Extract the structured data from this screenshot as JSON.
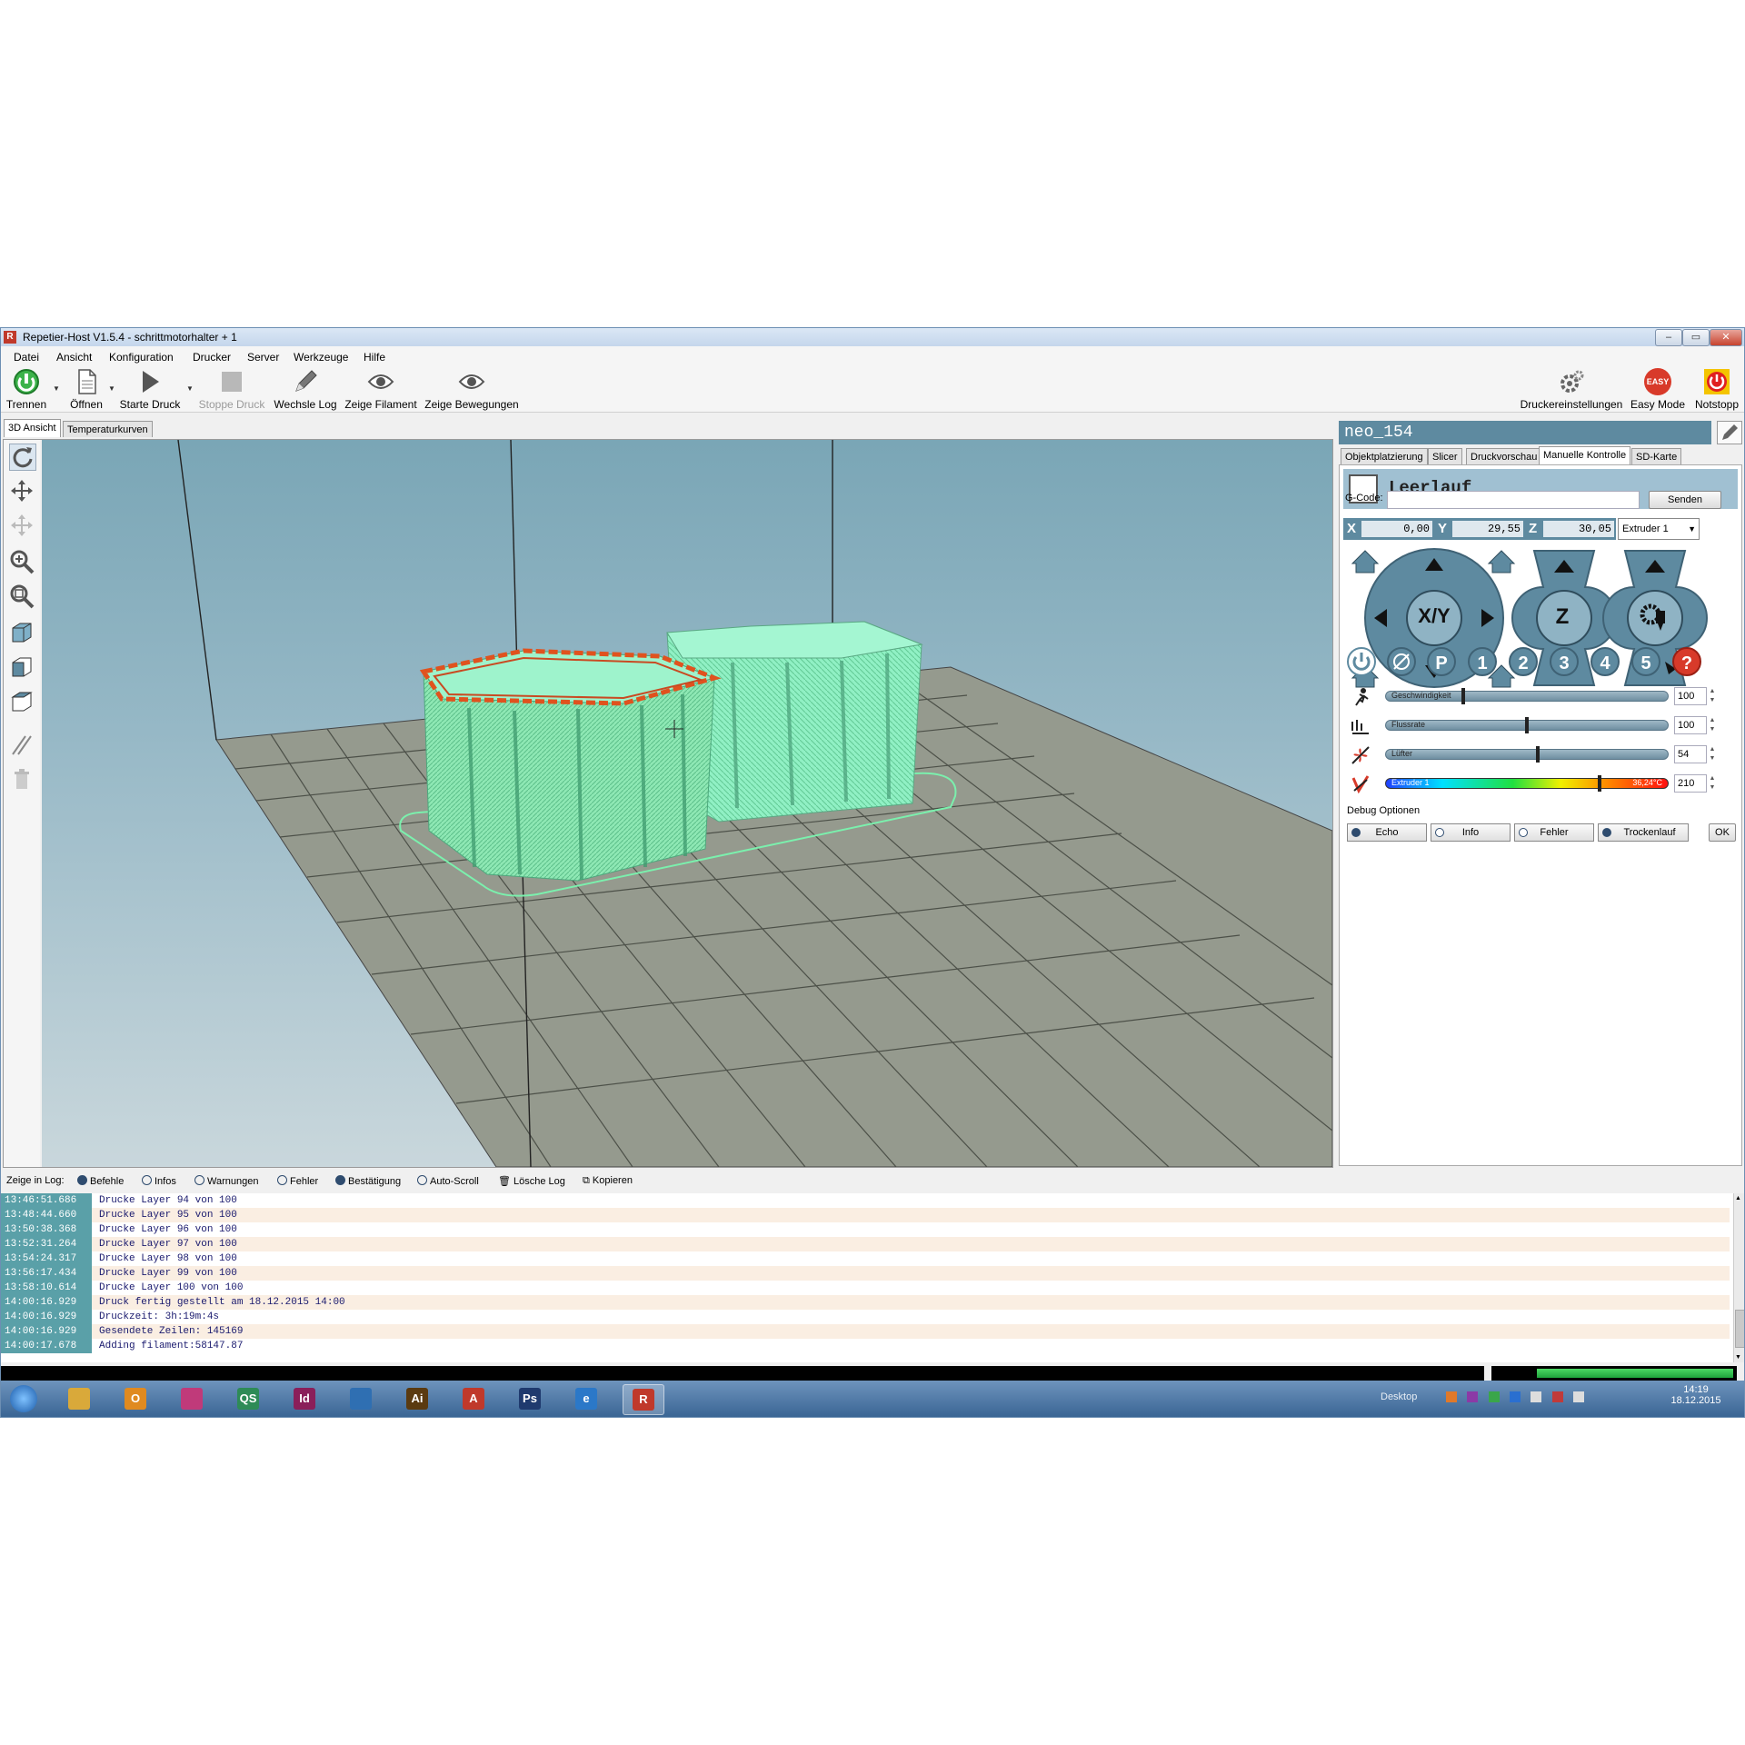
{
  "window": {
    "title": "Repetier-Host V1.5.4 - schrittmotorhalter + 1",
    "app_icon": "R"
  },
  "menu": [
    "Datei",
    "Ansicht",
    "Konfiguration",
    "Drucker",
    "Server",
    "Werkzeuge",
    "Hilfe"
  ],
  "toolbar": {
    "trennen": "Trennen",
    "oeffnen": "Öffnen",
    "starte_druck": "Starte Druck",
    "stoppe_druck": "Stoppe Druck",
    "wechsle_log": "Wechsle Log",
    "zeige_filament": "Zeige Filament",
    "zeige_bewegungen": "Zeige Bewegungen",
    "druckereinstellungen": "Druckereinstellungen",
    "easy_mode": "Easy Mode",
    "easy_badge": "EASY",
    "notstopp": "Notstopp"
  },
  "left_tabs": [
    "3D Ansicht",
    "Temperaturkurven"
  ],
  "printer": {
    "name": "neo_154",
    "tabs": [
      "Objektplatzierung",
      "Slicer",
      "Druckvorschau",
      "Manuelle Kontrolle",
      "SD-Karte"
    ],
    "status": "Leerlauf",
    "gcode_label": "G-Code:",
    "gcode_value": "",
    "send_label": "Senden",
    "x_label": "X",
    "x_value": "0,00",
    "y_label": "Y",
    "y_value": "29,55",
    "z_label": "Z",
    "z_value": "30,05",
    "extruder_select": "Extruder 1",
    "xy_label": "X/Y",
    "z_pad_label": "Z",
    "home_y": "Y",
    "home_z": "Z",
    "home_x": "X",
    "quick_buttons": [
      "P",
      "1",
      "2",
      "3",
      "4",
      "5",
      "?"
    ],
    "sliders": {
      "speed": {
        "label": "Geschwindigkeit",
        "value": "100",
        "level": 0.27
      },
      "flow": {
        "label": "Flussrate",
        "value": "100",
        "level": 0.5
      },
      "fan": {
        "label": "Lüfter",
        "value": "54",
        "level": 0.54
      },
      "extruder": {
        "label": "Extruder 1",
        "temp_text": "36,24°C",
        "value": "210",
        "level": 0.76
      }
    },
    "debug_title": "Debug Optionen",
    "debug": [
      "Echo",
      "Info",
      "Fehler",
      "Trockenlauf"
    ],
    "ok_label": "OK"
  },
  "log": {
    "show_label": "Zeige in Log:",
    "options": [
      {
        "label": "Befehle",
        "on": true
      },
      {
        "label": "Infos",
        "on": false
      },
      {
        "label": "Warnungen",
        "on": false
      },
      {
        "label": "Fehler",
        "on": false
      },
      {
        "label": "Bestätigung",
        "on": true
      },
      {
        "label": "Auto-Scroll",
        "on": false
      }
    ],
    "clear_label": "Lösche Log",
    "copy_label": "Kopieren",
    "rows": [
      {
        "ts": "13:46:51.686",
        "msg": "Drucke Layer 94 von 100"
      },
      {
        "ts": "13:48:44.660",
        "msg": "Drucke Layer 95 von 100"
      },
      {
        "ts": "13:50:38.368",
        "msg": "Drucke Layer 96 von 100"
      },
      {
        "ts": "13:52:31.264",
        "msg": "Drucke Layer 97 von 100"
      },
      {
        "ts": "13:54:24.317",
        "msg": "Drucke Layer 98 von 100"
      },
      {
        "ts": "13:56:17.434",
        "msg": "Drucke Layer 99 von 100"
      },
      {
        "ts": "13:58:10.614",
        "msg": "Drucke Layer 100 von 100"
      },
      {
        "ts": "14:00:16.929",
        "msg": "Druck fertig gestellt am 18.12.2015 14:00"
      },
      {
        "ts": "14:00:16.929",
        "msg": "Druckzeit: 3h:19m:4s"
      },
      {
        "ts": "14:00:16.929",
        "msg": "Gesendete Zeilen: 145169"
      },
      {
        "ts": "14:00:17.678",
        "msg": "Adding filament:58147.87"
      }
    ]
  },
  "taskbar": {
    "apps": [
      {
        "glyph": "",
        "color": "#d9a93a"
      },
      {
        "glyph": "O",
        "color": "#e08a20"
      },
      {
        "glyph": "",
        "color": "#c03a7a"
      },
      {
        "glyph": "QS",
        "color": "#2e8b57"
      },
      {
        "glyph": "Id",
        "color": "#8a1f5a"
      },
      {
        "glyph": "",
        "color": "#2f6fb2"
      },
      {
        "glyph": "Ai",
        "color": "#5a3a10"
      },
      {
        "glyph": "A",
        "color": "#c0392b"
      },
      {
        "glyph": "Ps",
        "color": "#1f3a6e"
      },
      {
        "glyph": "e",
        "color": "#2b78c8"
      },
      {
        "glyph": "R",
        "color": "#c0392b"
      }
    ],
    "desktop_label": "Desktop",
    "time": "14:19",
    "date": "18.12.2015"
  }
}
